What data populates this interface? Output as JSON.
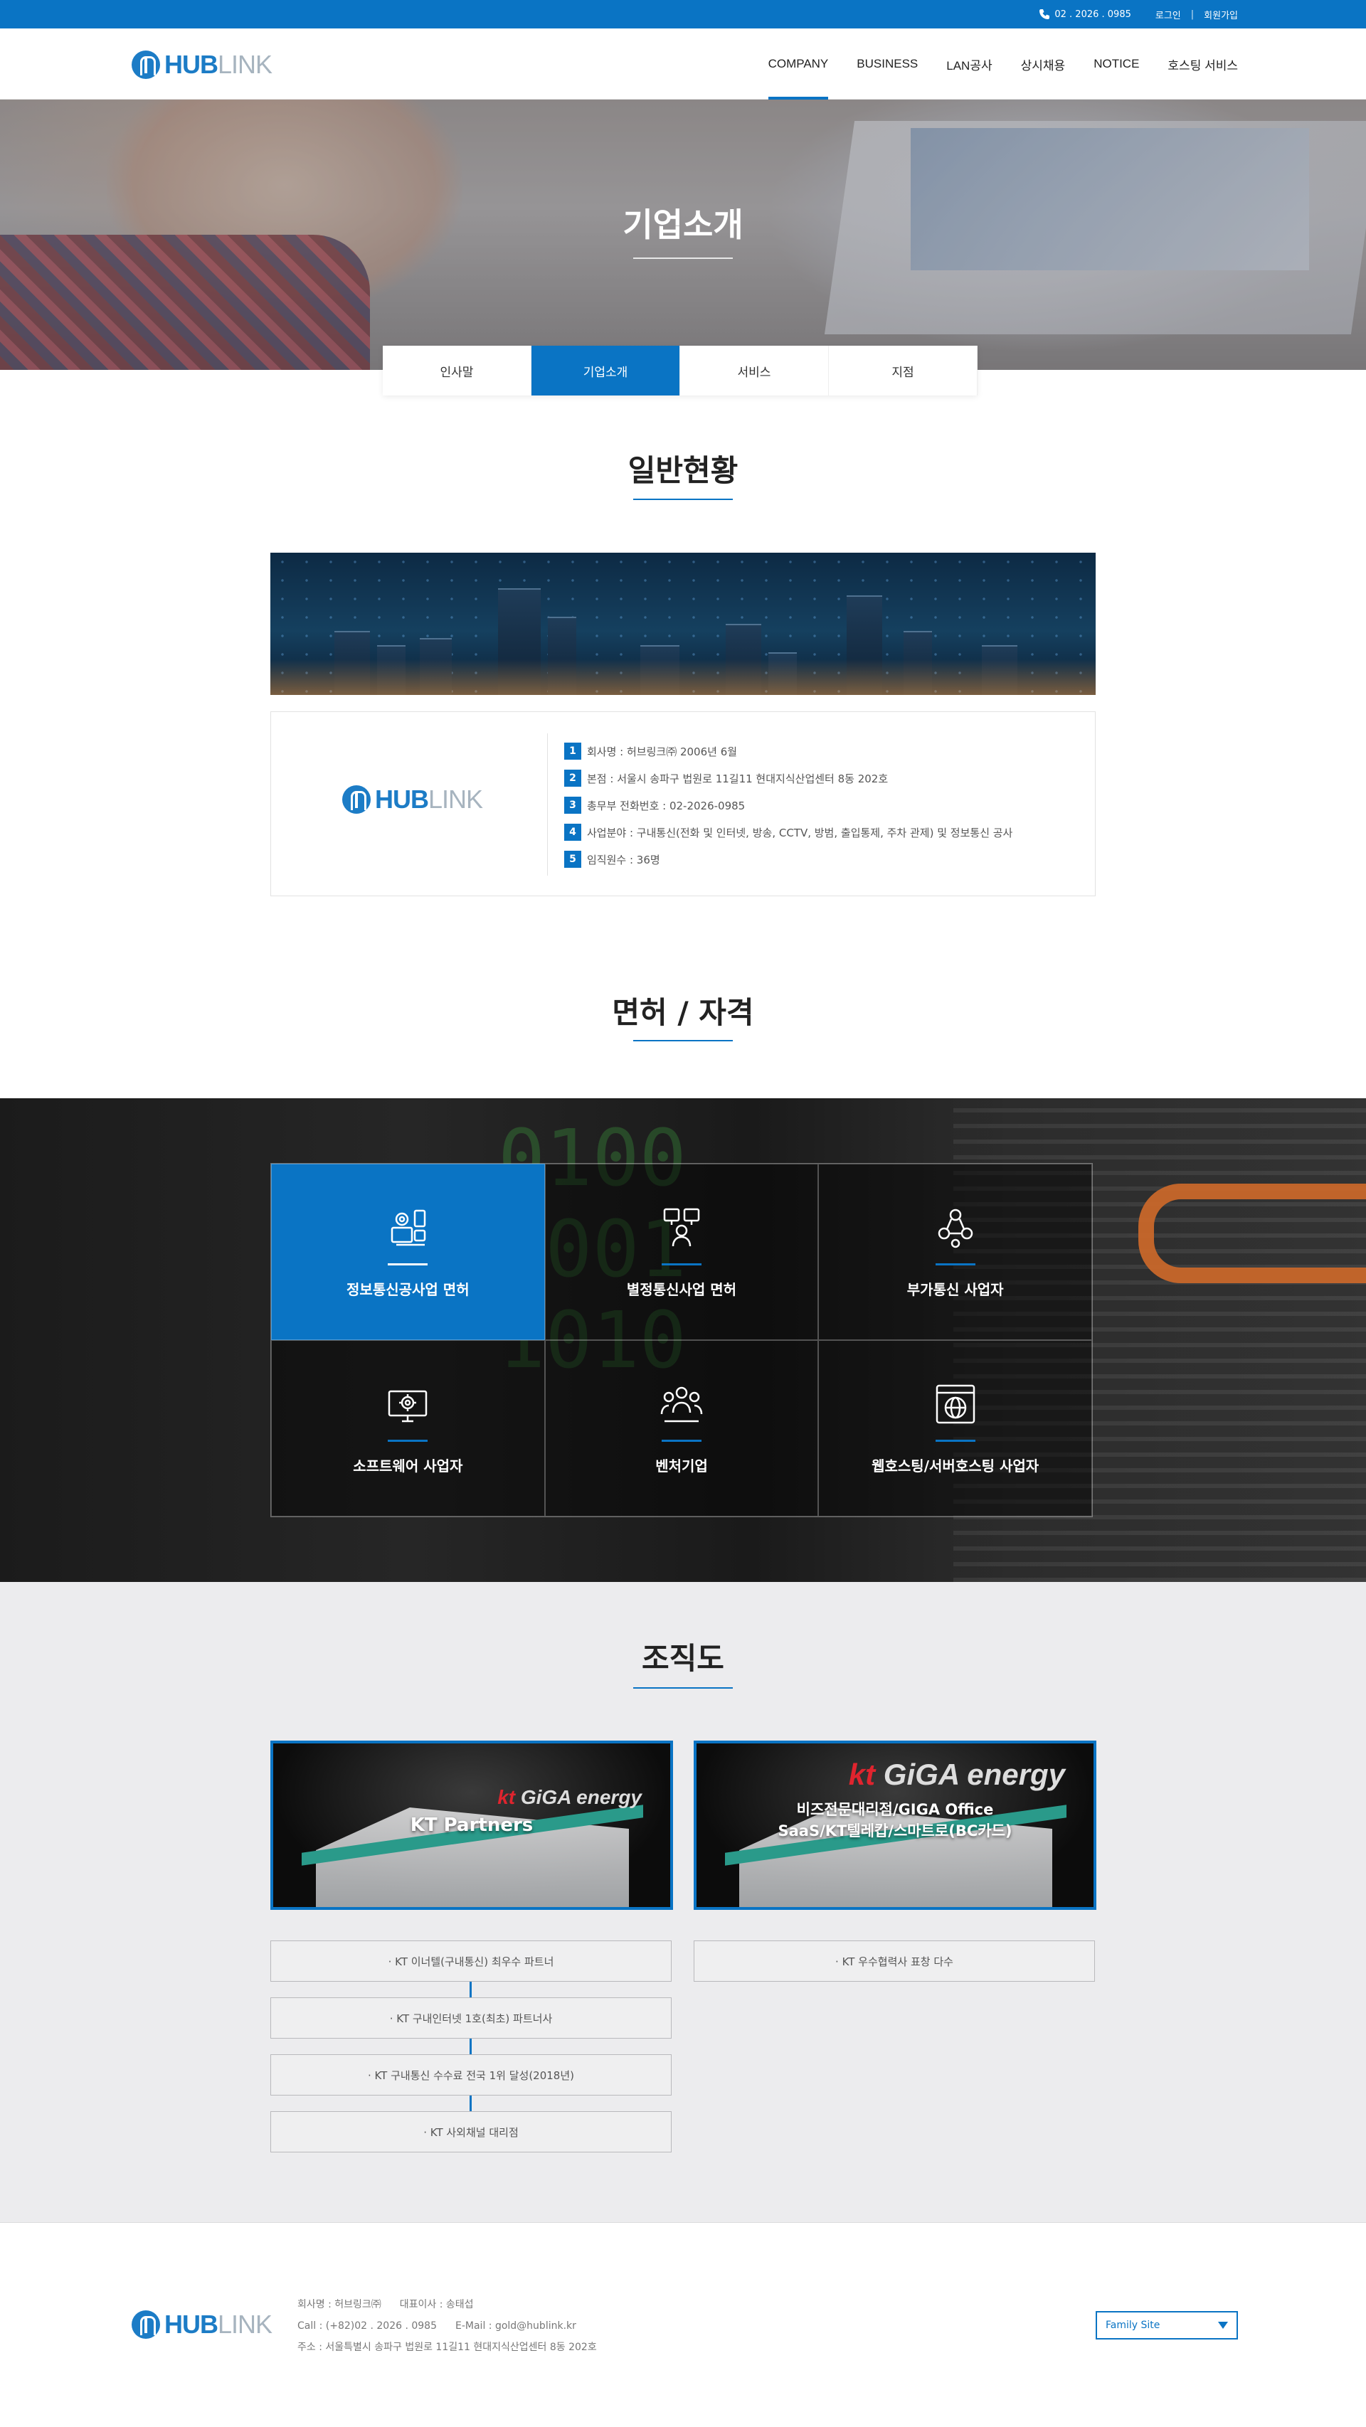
{
  "topbar": {
    "phone": "02 . 2026 . 0985",
    "login": "로그인",
    "separator": "|",
    "signup": "회원가입"
  },
  "brand": {
    "hub": "HUB",
    "link": "LINK"
  },
  "nav": [
    "COMPANY",
    "BUSINESS",
    "LAN공사",
    "상시채용",
    "NOTICE",
    "호스팅 서비스"
  ],
  "hero": {
    "title": "기업소개"
  },
  "subtabs": [
    "인사말",
    "기업소개",
    "서비스",
    "지점"
  ],
  "general": {
    "title": "일반현황",
    "items": [
      {
        "num": "1",
        "text": "회사명 : 허브링크㈜ 2006년 6월"
      },
      {
        "num": "2",
        "text": "본점 : 서울시 송파구 법원로 11길11 현대지식산업센터 8동 202호"
      },
      {
        "num": "3",
        "text": "총무부 전화번호 : 02-2026-0985"
      },
      {
        "num": "4",
        "text": "사업분야 : 구내통신(전화 및 인터넷, 방송, CCTV, 방범, 출입통제, 주차 관제) 및 정보통신 공사"
      },
      {
        "num": "5",
        "text": "임직원수 : 36명"
      }
    ]
  },
  "license": {
    "title": "면허 / 자격",
    "binary": "0100\n0001\n1010",
    "items": [
      {
        "label": "정보통신공사업 면허",
        "icon": "gear-mobile-icon"
      },
      {
        "label": "별정통신사업 면허",
        "icon": "network-user-icon"
      },
      {
        "label": "부가통신 사업자",
        "icon": "users-network-icon"
      },
      {
        "label": "소프트웨어 사업자",
        "icon": "monitor-gear-icon"
      },
      {
        "label": "벤처기업",
        "icon": "team-icon"
      },
      {
        "label": "웹호스팅/서버호스팅 사업자",
        "icon": "web-globe-icon"
      }
    ]
  },
  "org": {
    "title": "조직도",
    "left": {
      "card_title": "KT Partners",
      "brand_kt": "kt",
      "brand_rest": " GiGA energy",
      "items": [
        "· KT 이너텔(구내통신) 최우수 파트너",
        "· KT 구내인터넷 1호(최초) 파트너사",
        "· KT 구내통신 수수료 전국 1위 달성(2018년)",
        "· KT 사외채널 대리점"
      ]
    },
    "right": {
      "card_line1": "비즈전문대리점/GIGA Office",
      "card_line2": "SaaS/KT텔레캅/스마트로(BC카드)",
      "brand_kt": "kt",
      "brand_rest": " GiGA energy",
      "items": [
        "· KT 우수협력사 표창 다수"
      ]
    }
  },
  "footer": {
    "company": "회사명 : 허브링크㈜",
    "ceo": "대표이사 : 송태섭",
    "call": "Call : (+82)02 . 2026 . 0985",
    "email": "E-Mail : gold@hublink.kr",
    "address": "주소 : 서울특별시 송파구 법원로 11길11 현대지식산업센터 8동 202호",
    "family_site": "Family Site"
  },
  "colors": {
    "primary": "#0a74c4",
    "org_bg": "#ececee",
    "license_active": "#0a74c4"
  }
}
